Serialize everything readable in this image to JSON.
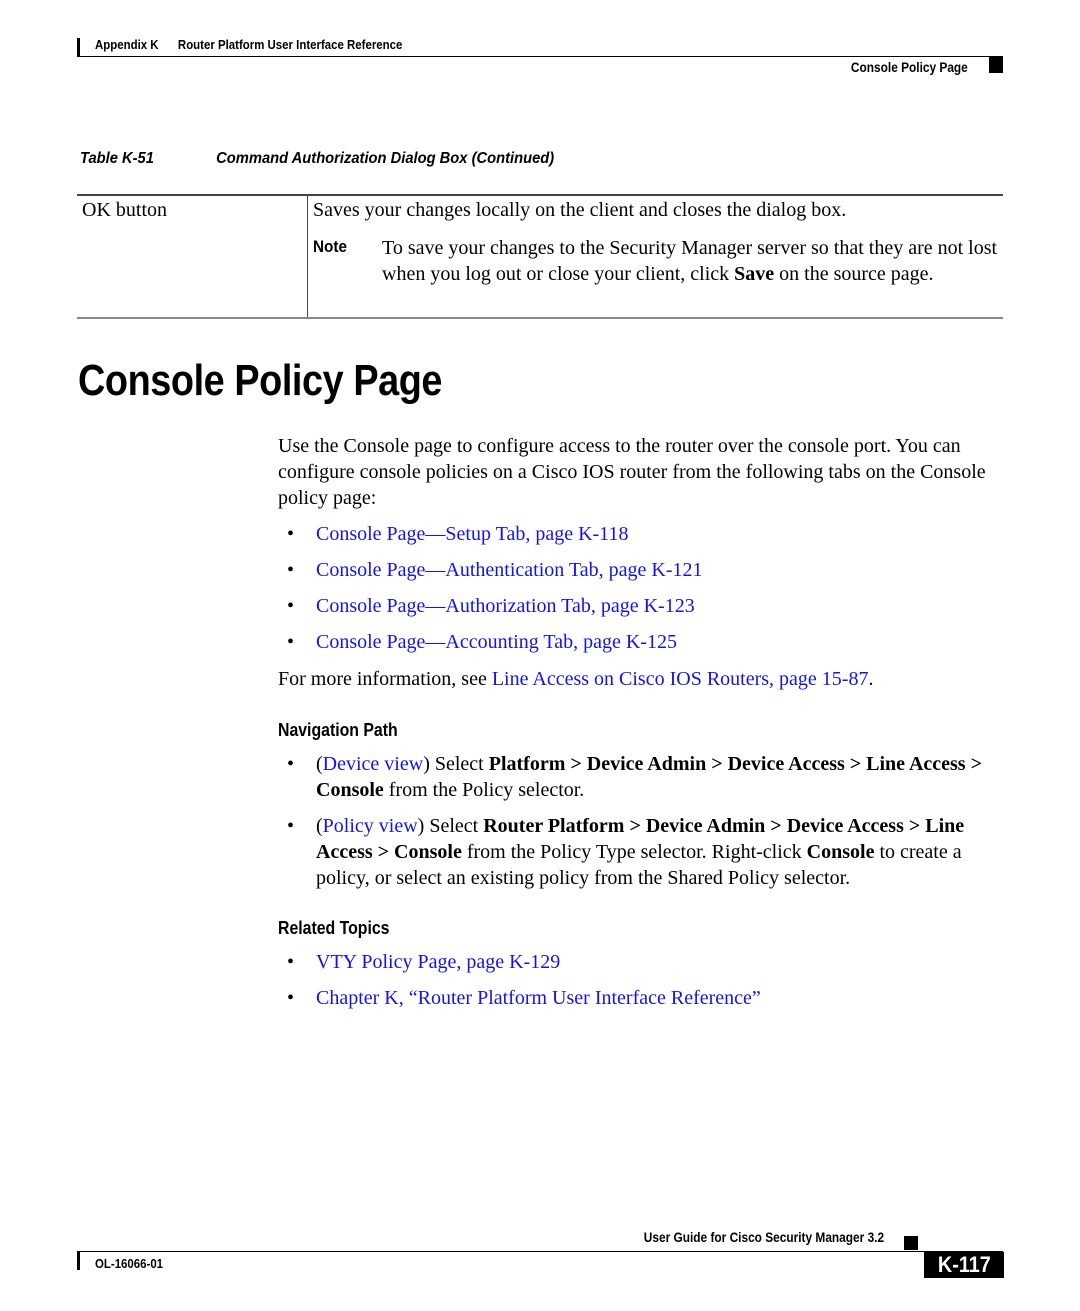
{
  "header": {
    "appendix": "Appendix K",
    "chapter_title": "Router Platform User Interface Reference",
    "section": "Console Policy Page"
  },
  "table": {
    "number": "Table K-51",
    "title": "Command Authorization Dialog Box (Continued)",
    "rows": [
      {
        "element": "OK button",
        "description": "Saves your changes locally on the client and closes the dialog box.",
        "note_label": "Note",
        "note_before": "To save your changes to the Security Manager server so that they are not lost when you log out or close your client, click ",
        "note_bold": "Save",
        "note_after": " on the source page."
      }
    ]
  },
  "page_title": "Console Policy Page",
  "intro": "Use the Console page to configure access to the router over the console port. You can configure console policies on a Cisco IOS router from the following tabs on the Console policy page:",
  "bullet_glyph": "•",
  "tab_links": [
    "Console Page—Setup Tab, page K-118",
    "Console Page—Authentication Tab, page K-121",
    "Console Page—Authorization Tab, page K-123",
    "Console Page—Accounting Tab, page K-125"
  ],
  "more_info": {
    "prefix": "For more information, see ",
    "link": "Line Access on Cisco IOS Routers, page 15-87",
    "suffix": "."
  },
  "navigation_path": {
    "heading": "Navigation Path",
    "items": [
      {
        "paren_open": "(",
        "link": "Device view",
        "paren_close": ")",
        "text1": " Select ",
        "bold1": "Platform > Device Admin > Device Access > Line Access > Console",
        "text2": " from the Policy selector.",
        "bold2": "",
        "text3": ""
      },
      {
        "paren_open": "(",
        "link": "Policy view",
        "paren_close": ")",
        "text1": " Select ",
        "bold1": "Router Platform > Device Admin > Device Access > Line Access > Console",
        "text2": " from the Policy Type selector. Right-click ",
        "bold2": "Console",
        "text3": " to create a policy, or select an existing policy from the Shared Policy selector."
      }
    ]
  },
  "related_topics": {
    "heading": "Related Topics",
    "links": [
      "VTY Policy Page, page K-129",
      "Chapter K, “Router Platform User Interface Reference”"
    ]
  },
  "footer": {
    "guide_title": "User Guide for Cisco Security Manager 3.2",
    "doc_number": "OL-16066-01",
    "page_number": "K-117"
  },
  "colors": {
    "link": "#1414e6",
    "text": "#000000"
  }
}
